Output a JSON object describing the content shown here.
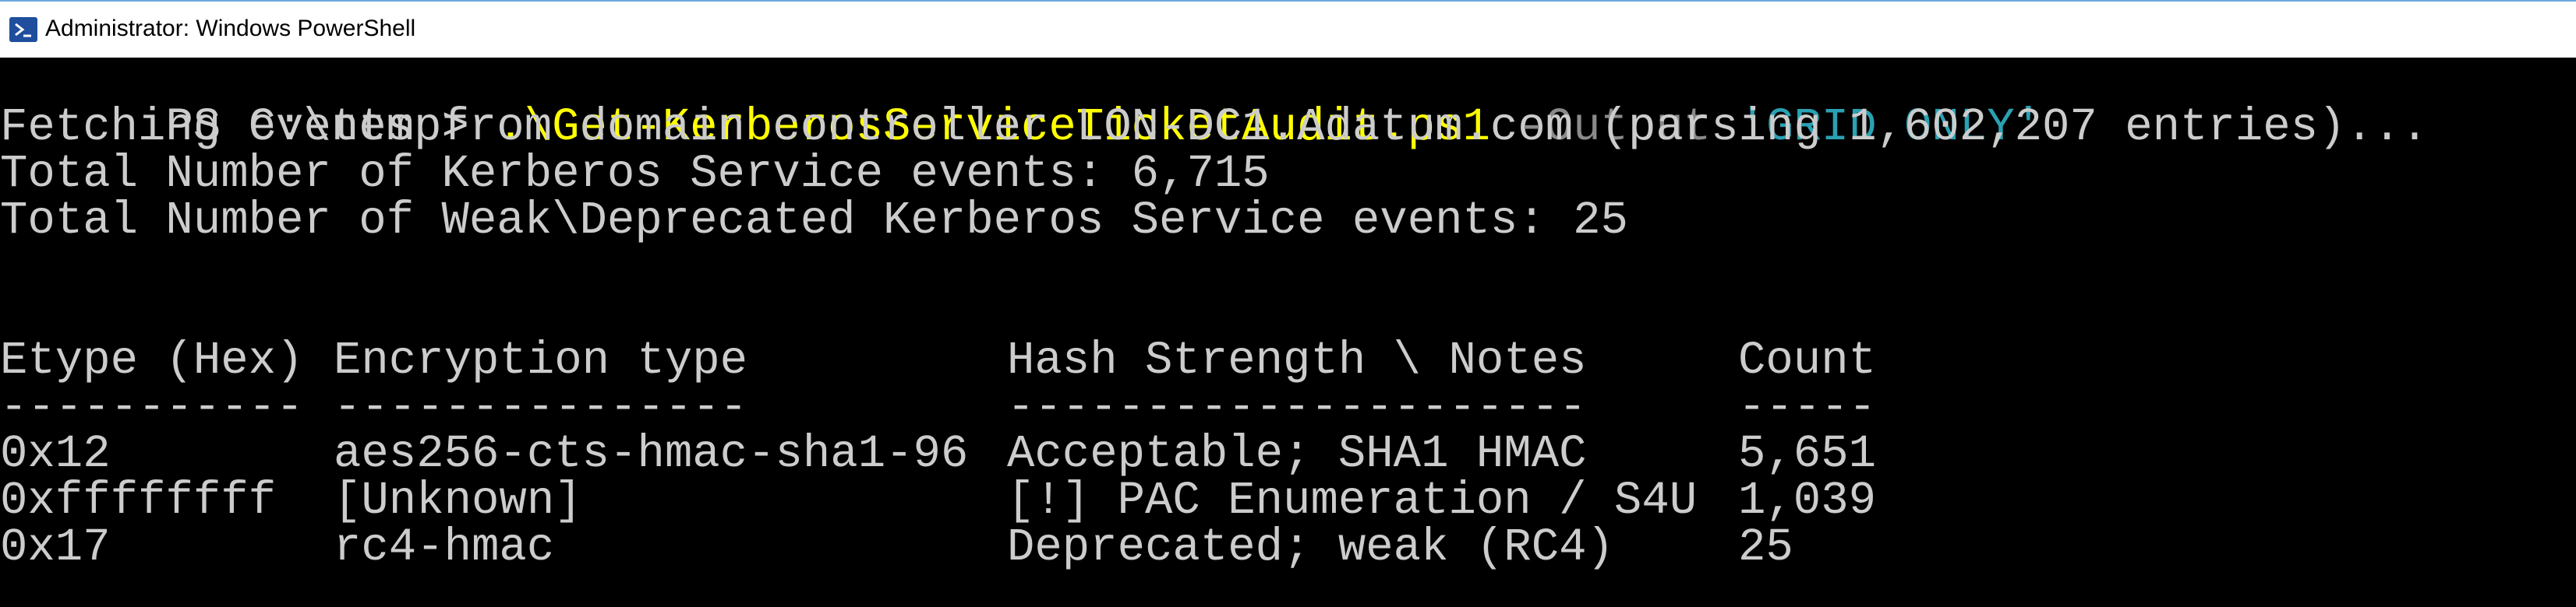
{
  "window": {
    "title": "Administrator: Windows PowerShell",
    "icon": "powershell-icon"
  },
  "console": {
    "prompt": "PS C:\\temp>",
    "command": ".\\Get-KerberosServiceTicketAudit.ps1",
    "parameter": "-Output",
    "argument": "'GRID ONLY'",
    "output_lines": [
      "Fetching events from domain controller LON-DC1.Adatum.com (parsing 1,602,207 entries)...",
      "Total Number of Kerberos Service events: 6,715",
      "Total Number of Weak\\Deprecated Kerberos Service events: 25"
    ],
    "table": {
      "headers": [
        "Etype (Hex)",
        "Encryption type",
        "Hash Strength \\ Notes",
        "Count"
      ],
      "separators": [
        "-----------",
        "---------------",
        "---------------------",
        "-----"
      ],
      "rows": [
        [
          "0x12",
          "aes256-cts-hmac-sha1-96",
          "Acceptable; SHA1 HMAC",
          "5,651"
        ],
        [
          "0xffffffff",
          "[Unknown]",
          "[!] PAC Enumeration / S4U",
          "1,039"
        ],
        [
          "0x17",
          "rc4-hmac",
          "Deprecated; weak (RC4)",
          "25"
        ]
      ]
    }
  },
  "colors": {
    "background": "#000000",
    "text": "#cccccc",
    "command": "#ffff00",
    "parameter": "#8a8a8a",
    "string": "#2aa1b3",
    "titlebar": "#ffffff"
  }
}
